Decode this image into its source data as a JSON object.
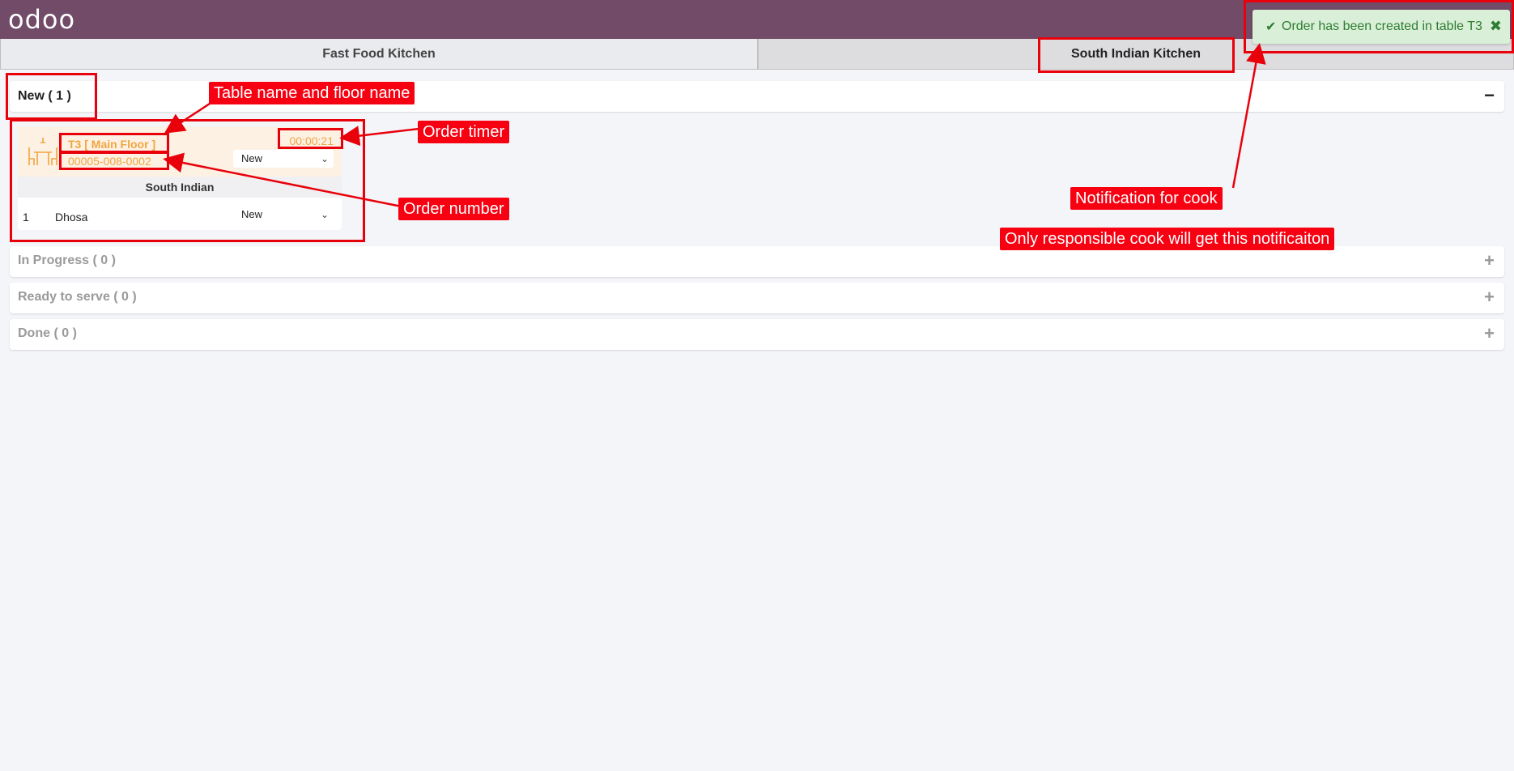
{
  "app": {
    "logo": "odoo"
  },
  "tabs": [
    {
      "label": "Fast Food Kitchen"
    },
    {
      "label": "South Indian Kitchen"
    }
  ],
  "sections": {
    "new": {
      "title": "New ( 1 )",
      "toggle": "−"
    },
    "in_progress": {
      "title": "In Progress ( 0 )",
      "toggle": "+"
    },
    "ready": {
      "title": "Ready to serve ( 0 )",
      "toggle": "+"
    },
    "done": {
      "title": "Done ( 0 )",
      "toggle": "+"
    }
  },
  "order": {
    "table_name": "T3 [ Main Floor ]",
    "order_number": "00005-008-0002",
    "timer": "00:00:21",
    "status": "New",
    "category": "South Indian",
    "lines": [
      {
        "qty": "1",
        "name": "Dhosa",
        "status": "New"
      }
    ]
  },
  "notification": {
    "text": "Order has been created in table T3",
    "check_icon": "check-icon",
    "close_icon": "close-icon"
  },
  "annotations": {
    "table_floor": "Table name and floor name",
    "timer": "Order timer",
    "order_number": "Order number",
    "notification": "Notification for cook",
    "responsible": "Only responsible cook will get this notificaiton"
  },
  "colors": {
    "topbar": "#714b67",
    "accent_orange": "#f0a640",
    "annotation_red": "#f70011",
    "notification_green": "#2e7d32"
  }
}
